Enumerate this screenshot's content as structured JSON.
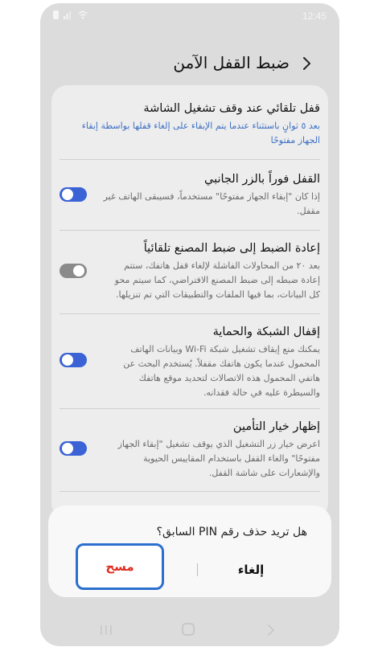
{
  "status": {
    "time": "12:45"
  },
  "header": {
    "title": "ضبط القفل الآمن"
  },
  "settings": [
    {
      "title": "قفل تلقائي عند وقف تشغيل الشاشة",
      "description": "بعد ٥ ثوانٍ باستثناء عندما يتم الإبقاء على إلغاء قفلها بواسطة إبقاء الجهاز مفتوحًا"
    },
    {
      "title": "القفل فوراً بالزر الجانبي",
      "description": "إذا كان \"إبقاء الجهاز مفتوحًا\" مستخدماً، فسيبقى الهاتف غير مقفل.",
      "toggle": "on"
    },
    {
      "title": "إعادة الضبط إلى ضبط المصنع تلقائياً",
      "description": "بعد ٢٠ من المحاولات الفاشلة لإلغاء قفل هاتفك، ستتم إعادة ضبطه إلى ضبط المصنع الافتراضي، كما سيتم محو كل البيانات، بما فيها الملفات والتطبيقات التي تم تنزيلها.",
      "toggle": "off"
    },
    {
      "title": "إقفال الشبكة والحماية",
      "description": "يمكنك منع إيقاف تشغيل شبكة Wi-Fi وبيانات الهاتف المحمول عندما يكون هاتفك مقفلاً. يُستخدم البحث عن هاتفي المحمول هذه الاتصالات لتحديد موقع هاتفك والسيطرة عليه في حالة فقدانه.",
      "toggle": "on"
    },
    {
      "title": "إظهار خيار التأمين",
      "description": "اعرض خيار زر التشغيل الذي يوقف تشغيل \"إبقاء الجهاز مفتوحًا\" والغاء القفل باستخدام المقاييس الحيوية والإشعارات على شاشة القفل.",
      "toggle": "on"
    }
  ],
  "dialog": {
    "question": "هل تريد حذف رقم PIN السابق؟",
    "cancel_label": "إلغاء",
    "delete_label": "مسح"
  },
  "colors": {
    "accent": "#3b63d6",
    "delete": "#e0291c",
    "highlight": "#2b6fcf"
  }
}
